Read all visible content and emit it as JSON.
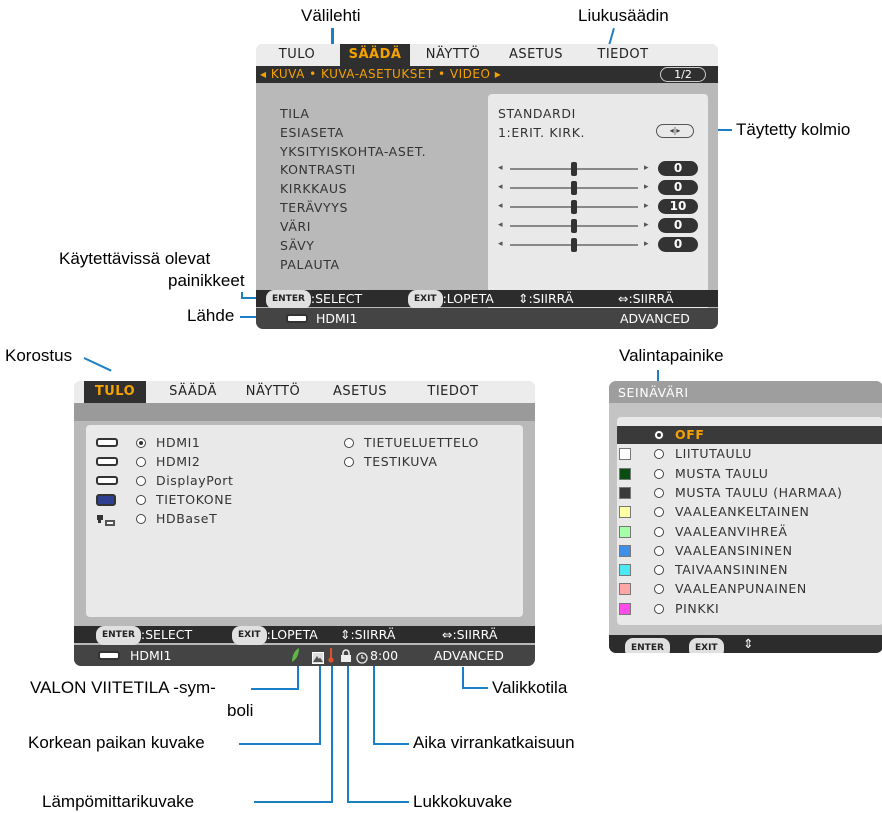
{
  "callouts": {
    "tab_label": "Välilehti",
    "slider_label": "Liukusäädin",
    "triangle_label": "Täytetty kolmio",
    "available_buttons_line1": "Käytettävissä olevat",
    "available_buttons_line2": "painikkeet",
    "source_label": "Lähde",
    "highlight_label": "Korostus",
    "radio_label": "Valintapainike",
    "eco_line1": "VALON VIITETILA -sym-",
    "eco_line2": "boli",
    "menu_mode_label": "Valikkotila",
    "high_altitude_label": "Korkean paikan kuvake",
    "off_timer_label": "Aika virrankatkaisuun",
    "thermometer_label": "Lämpömittarikuvake",
    "lock_label": "Lukkokuvake"
  },
  "menu1": {
    "tabs": [
      "TULO",
      "SÄÄDÄ",
      "NÄYTTÖ",
      "ASETUS",
      "TIEDOT"
    ],
    "active_tab": "SÄÄDÄ",
    "subtabs": "◂ KUVA • KUVA-ASETUKSET • VIDEO ▸",
    "page": "1/2",
    "items": [
      "TILA",
      "ESIASETA",
      "YKSITYISKOHTA-ASET.",
      "KONTRASTI",
      "KIRKKAUS",
      "TERÄVYYS",
      "VÄRI",
      "SÄVY",
      "PALAUTA"
    ],
    "tila_value": "STANDARDI",
    "esiaseta_value": "1:ERIT. KIRK.",
    "slider_values": [
      "0",
      "0",
      "10",
      "0",
      "0"
    ],
    "slider_levels": [
      0.5,
      0.5,
      0.5,
      0.5,
      0.5
    ],
    "footer": {
      "enter": "ENTER",
      "select": ":SELECT",
      "exit": "EXIT",
      "lopeta": ":LOPETA",
      "move_ud": "⇕:SIIRRÄ",
      "move_lr": "⇔:SIIRRÄ"
    },
    "source": "HDMI1",
    "mode": "ADVANCED"
  },
  "menu2": {
    "tabs": [
      "TULO",
      "SÄÄDÄ",
      "NÄYTTÖ",
      "ASETUS",
      "TIEDOT"
    ],
    "active_tab": "TULO",
    "inputs_left": [
      "HDMI1",
      "HDMI2",
      "DisplayPort",
      "TIETOKONE",
      "HDBaseT"
    ],
    "inputs_right": [
      "TIETUELUETTELO",
      "TESTIKUVA"
    ],
    "selected_input": "HDMI1",
    "footer": {
      "enter": "ENTER",
      "select": ":SELECT",
      "exit": "EXIT",
      "lopeta": ":LOPETA",
      "move_ud": "⇕:SIIRRÄ",
      "move_lr": "⇔:SIIRRÄ"
    },
    "source": "HDMI1",
    "timer": "8:00",
    "mode": "ADVANCED",
    "icons": [
      "eco-leaf-icon",
      "high-altitude-icon",
      "thermometer-icon",
      "lock-icon",
      "clock-icon"
    ]
  },
  "menu3": {
    "title": "SEINÄVÄRI",
    "options": [
      {
        "label": "OFF",
        "color": null,
        "selected": true
      },
      {
        "label": "LIITUTAULU",
        "color": "#ffffff"
      },
      {
        "label": "MUSTA TAULU",
        "color": "#0a4d12"
      },
      {
        "label": "MUSTA TAULU (HARMAA)",
        "color": "#3a3a3a"
      },
      {
        "label": "VAALEANKELTAINEN",
        "color": "#ffffa6"
      },
      {
        "label": "VAALEANVIHREÄ",
        "color": "#a6ffa6"
      },
      {
        "label": "VAALEANSININEN",
        "color": "#3f8ee8"
      },
      {
        "label": "TAIVAANSININEN",
        "color": "#4de8f5"
      },
      {
        "label": "VAALEANPUNAINEN",
        "color": "#ffa6a6"
      },
      {
        "label": "PINKKI",
        "color": "#ff4de8"
      }
    ],
    "footer": {
      "enter": "ENTER",
      "exit": "EXIT",
      "move": "⇕"
    }
  },
  "colors": {
    "accent": "#f5a200",
    "callout_line": "#1a7fc4",
    "eco_green": "#5fb547",
    "thermo_red": "#e0532a"
  }
}
